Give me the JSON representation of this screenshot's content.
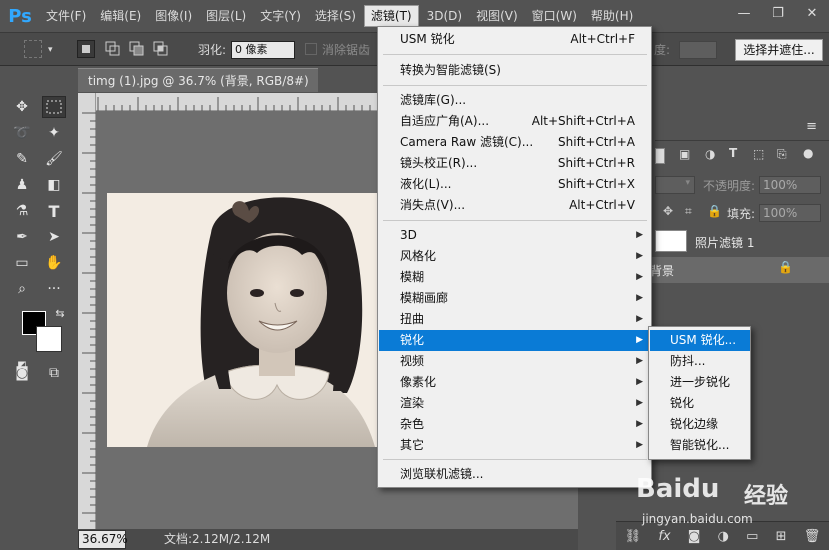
{
  "app": {
    "logo": "Ps"
  },
  "menubar": {
    "items": [
      "文件(F)",
      "编辑(E)",
      "图像(I)",
      "图层(L)",
      "文字(Y)",
      "选择(S)",
      "滤镜(T)",
      "3D(D)",
      "视图(V)",
      "窗口(W)",
      "帮助(H)"
    ],
    "active_index": 6
  },
  "window_controls": {
    "minimize": "—",
    "restore": "❐",
    "close": "✕"
  },
  "options_bar": {
    "feather_label": "羽化:",
    "feather_value": "0 像素",
    "antialias_label": "消除锯齿",
    "density_label": "度:",
    "select_and_mask": "选择并遮住..."
  },
  "document": {
    "tab_title": "timg (1).jpg @ 36.7% (背景, RGB/8#) *",
    "tab_close": "×",
    "zoom": "36.67%",
    "info": "文档:2.12M/2.12M"
  },
  "layers_panel": {
    "opacity_label": "不透明度:",
    "opacity_value": "100%",
    "fill_label": "填充:",
    "fill_value": "100%",
    "layers": [
      {
        "name": "照片滤镜 1"
      },
      {
        "name": "背景"
      }
    ]
  },
  "filter_menu": {
    "top_items": [
      {
        "label": "USM 锐化",
        "shortcut": "Alt+Ctrl+F"
      }
    ],
    "convert_item": {
      "label": "转换为智能滤镜(S)"
    },
    "gallery_items": [
      {
        "label": "滤镜库(G)...",
        "shortcut": ""
      },
      {
        "label": "自适应广角(A)...",
        "shortcut": "Alt+Shift+Ctrl+A"
      },
      {
        "label": "Camera Raw 滤镜(C)...",
        "shortcut": "Shift+Ctrl+A"
      },
      {
        "label": "镜头校正(R)...",
        "shortcut": "Shift+Ctrl+R"
      },
      {
        "label": "液化(L)...",
        "shortcut": "Shift+Ctrl+X"
      },
      {
        "label": "消失点(V)...",
        "shortcut": "Alt+Ctrl+V"
      }
    ],
    "sub_items": [
      {
        "label": "3D"
      },
      {
        "label": "风格化"
      },
      {
        "label": "模糊"
      },
      {
        "label": "模糊画廊"
      },
      {
        "label": "扭曲"
      },
      {
        "label": "锐化"
      },
      {
        "label": "视频"
      },
      {
        "label": "像素化"
      },
      {
        "label": "渲染"
      },
      {
        "label": "杂色"
      },
      {
        "label": "其它"
      }
    ],
    "highlighted_sub_index": 5,
    "browse_item": {
      "label": "浏览联机滤镜..."
    },
    "submenu_arrow": "▶"
  },
  "sharpen_submenu": {
    "items": [
      "USM 锐化...",
      "防抖...",
      "进一步锐化",
      "锐化",
      "锐化边缘",
      "智能锐化..."
    ],
    "highlighted_index": 0
  },
  "colors": {
    "menu_highlight": "#0a7bd6",
    "ps_logo": "#31a8ff",
    "ui_dark": "#535353"
  },
  "watermark": {
    "brand": "Baidu",
    "suffix": "经验",
    "url": "jingyan.baidu.com"
  }
}
